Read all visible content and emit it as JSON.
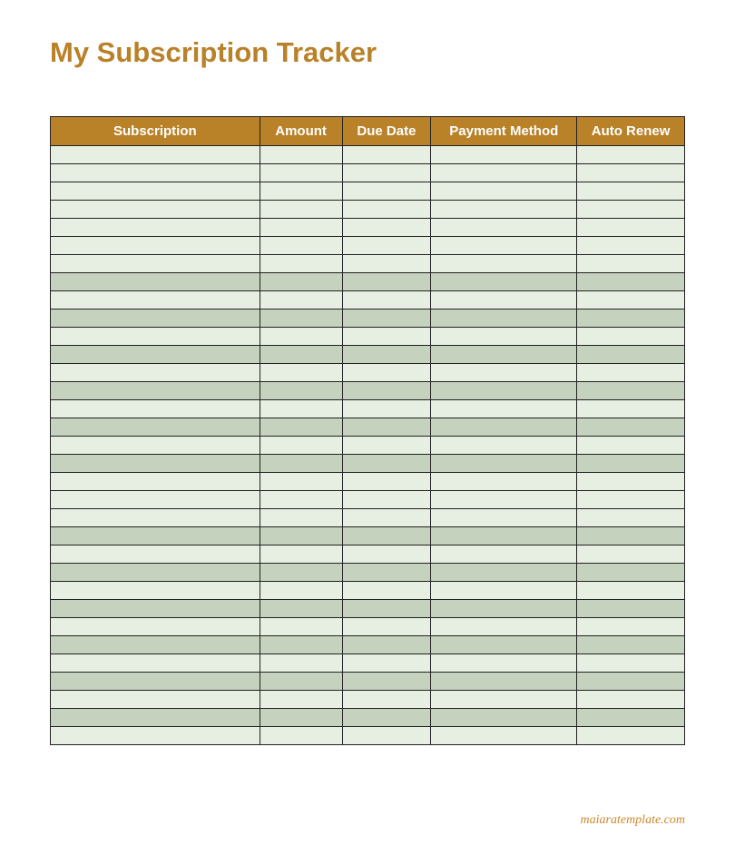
{
  "title": "My Subscription Tracker",
  "columns": {
    "subscription": "Subscription",
    "amount": "Amount",
    "duedate": "Due Date",
    "payment": "Payment Method",
    "autorenew": "Auto Renew"
  },
  "row_pattern": [
    "light",
    "light",
    "light",
    "light",
    "light",
    "light",
    "light",
    "dark",
    "light",
    "dark",
    "light",
    "dark",
    "light",
    "dark",
    "light",
    "dark",
    "light",
    "dark",
    "light",
    "light",
    "light",
    "dark",
    "light",
    "dark",
    "light",
    "dark",
    "light",
    "dark",
    "light",
    "dark",
    "light",
    "dark",
    "light"
  ],
  "footer": "maiaratemplate.com"
}
